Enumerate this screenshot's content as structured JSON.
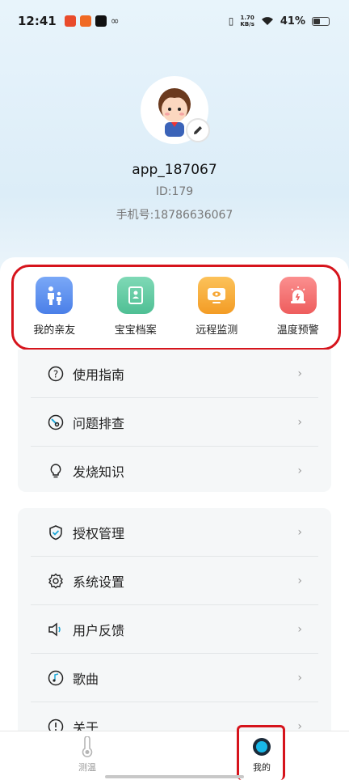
{
  "status_bar": {
    "time": "12:41",
    "net_speed_value": "1.70",
    "net_speed_unit": "KB/s",
    "battery": "41%"
  },
  "profile": {
    "username": "app_187067",
    "user_id": "ID:179",
    "phone": "手机号:18786636067"
  },
  "quick_actions": [
    {
      "label": "我的亲友",
      "icon": "family-icon",
      "color": "#5b8ff0"
    },
    {
      "label": "宝宝档案",
      "icon": "profile-book-icon",
      "color": "#5dc8a0"
    },
    {
      "label": "远程监测",
      "icon": "monitor-icon",
      "color": "#f7a93a"
    },
    {
      "label": "温度预警",
      "icon": "alarm-icon",
      "color": "#f36a6a"
    }
  ],
  "menu_group_1": [
    {
      "label": "使用指南",
      "icon": "help-icon"
    },
    {
      "label": "问题排查",
      "icon": "troubleshoot-icon"
    },
    {
      "label": "发烧知识",
      "icon": "bulb-icon"
    }
  ],
  "menu_group_2": [
    {
      "label": "授权管理",
      "icon": "shield-icon"
    },
    {
      "label": "系统设置",
      "icon": "gear-icon"
    },
    {
      "label": "用户反馈",
      "icon": "speaker-icon"
    },
    {
      "label": "歌曲",
      "icon": "music-icon"
    },
    {
      "label": "关于",
      "icon": "info-icon"
    }
  ],
  "tabbar": {
    "tab_measure": "测温",
    "tab_mine": "我的",
    "active_color": "#19b8e8"
  }
}
